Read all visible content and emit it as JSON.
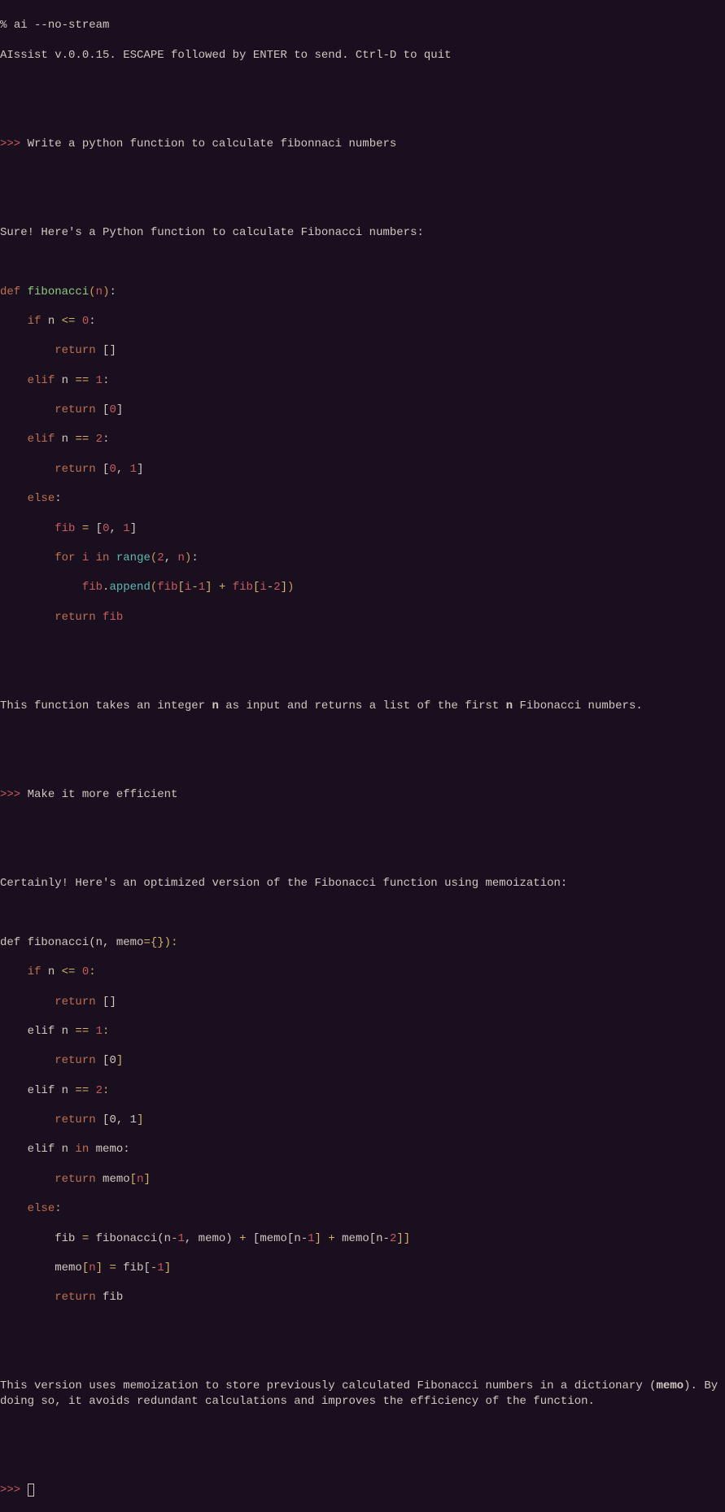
{
  "shell_prompt": "% ",
  "command": "ai --no-stream",
  "banner": "AIssist v.0.0.15. ESCAPE followed by ENTER to send. Ctrl-D to quit",
  "repl_prompt": ">>>",
  "user1": " Write a python function to calculate fibonnaci numbers",
  "resp1_intro": "Sure! Here's a Python function to calculate Fibonacci numbers:",
  "code1": {
    "def": "def",
    "fname": "fibonacci",
    "lp": "(",
    "n": "n",
    "rp": ")",
    "colon": ":",
    "if": "if",
    "lte": "<=",
    "zero": "0",
    "return": "return",
    "lb": "[",
    "rb": "]",
    "elif": "elif",
    "eqeq": "==",
    "one": "1",
    "two": "2",
    "comma": ",",
    "else": "else",
    "fib": "fib",
    "eq": "=",
    "for": "for",
    "i": "i",
    "in": "in",
    "range": "range",
    "dot": ".",
    "append": "append",
    "minus": "-",
    "plus": "+"
  },
  "resp1_outro_a": "This function takes an integer ",
  "resp1_outro_b": " as input and returns a list of the first ",
  "resp1_outro_c": " Fibonacci numbers.",
  "n_bold": "n",
  "user2": " Make it more efficient",
  "resp2_intro": "Certainly! Here's an optimized version of the Fibonacci function using memoization:",
  "code2": {
    "defline": "def fibonacci(n, memo",
    "eq": "=",
    "lbrace": "{",
    "rbrace": "}",
    "rp": ")",
    "colon": ":",
    "if": "if",
    "n": " n ",
    "lte": "<=",
    "sp0colon": " 0:",
    "zero": "0",
    "return": "return",
    "empty": " []",
    "elif_n": "    elif n ",
    "eqeq": "==",
    "sp1colon": " 1:",
    "one": "1",
    "ret0": " [0",
    "rb": "]",
    "sp2colon": " 2:",
    "two": "2",
    "ret01": " [0, 1",
    "in": "in",
    "memo_colon": " memo:",
    "memo_sp": " memo",
    "lb": "[",
    "else": "else",
    "fib_eq_pre": "        fib ",
    "eqsym": "=",
    "fib_call": " fibonacci(n",
    "minus": "-",
    "memo_rp": ", memo) ",
    "plus": "+",
    "sp_lb": " [",
    "memo_br": "memo[n-",
    "sp_memo_br": " memo[n-",
    "rbrb": "]]",
    "memo_n_pre": "        memo",
    "fib_slice": " fib[",
    "neg1": "-1",
    "ret_fib": " fib"
  },
  "resp2_outro_a": "This version uses memoization to store previously calculated Fibonacci numbers in a dictionary (",
  "memo_bold": "memo",
  "resp2_outro_b": "). By doing so, it avoids redundant calculations and improves the efficiency of the function."
}
